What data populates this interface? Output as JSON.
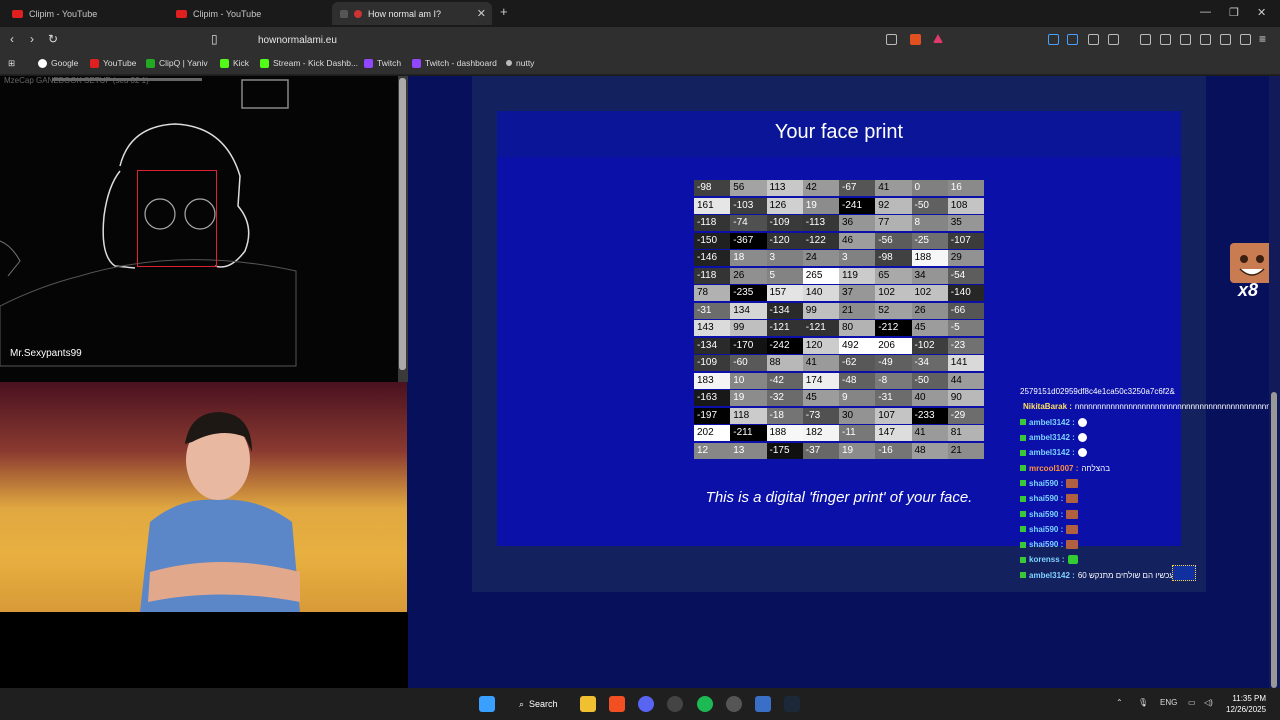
{
  "tabs": [
    {
      "title": "Clipim - YouTube"
    },
    {
      "title": "Clipim - YouTube"
    },
    {
      "title": "How normal am I?"
    }
  ],
  "url": "hownormalami.eu",
  "bookmarks": [
    "Google",
    "YouTube",
    "ClipQ | Yaniv",
    "Kick",
    "Stream - Kick Dashb...",
    "Twitch",
    "Twitch - dashboard",
    "nutty"
  ],
  "webcam": {
    "label": "Mr.Sexypants99",
    "overlay_text": "MzeCap GANEBOOK SETUP (seu 32 1)"
  },
  "card": {
    "title": "Your face print",
    "caption": "This is a digital 'finger print' of your face."
  },
  "faceprint": [
    [
      -98,
      56,
      113,
      42,
      -67,
      41,
      0,
      16
    ],
    [
      161,
      -103,
      126,
      19,
      -241,
      92,
      -50,
      108
    ],
    [
      -118,
      -74,
      -109,
      -113,
      36,
      77,
      8,
      35
    ],
    [
      -150,
      -367,
      -120,
      -122,
      46,
      -56,
      -25,
      -107
    ],
    [
      -146,
      18,
      3,
      24,
      3,
      -98,
      188,
      29
    ],
    [
      -118,
      26,
      5,
      265,
      119,
      65,
      34,
      -54
    ],
    [
      78,
      -235,
      157,
      140,
      37,
      102,
      102,
      -140
    ],
    [
      -31,
      134,
      -134,
      99,
      21,
      52,
      26,
      -66
    ],
    [
      143,
      99,
      -121,
      -121,
      80,
      -212,
      45,
      -5
    ],
    [
      -134,
      -170,
      -242,
      120,
      492,
      206,
      -102,
      -23
    ],
    [
      -109,
      -60,
      88,
      41,
      -62,
      -49,
      -34,
      141
    ],
    [
      183,
      10,
      -42,
      174,
      -48,
      -8,
      -50,
      44
    ],
    [
      -163,
      19,
      -32,
      45,
      9,
      -31,
      40,
      90
    ],
    [
      -197,
      118,
      -18,
      -73,
      30,
      107,
      -233,
      -29
    ],
    [
      202,
      -211,
      188,
      182,
      -11,
      147,
      41,
      81
    ],
    [
      12,
      13,
      -175,
      -37,
      19,
      -16,
      48,
      21
    ]
  ],
  "chat": {
    "hash": "2579151d02959df8c4e1ca50c3250a7c6f2&",
    "messages": [
      {
        "user": "NikitaBarak",
        "text": "nnnnnnnnnnnnnnnnnnnnnnnnnnnnnnnnnnnnnnnnnnnnnn",
        "emote": "",
        "color": "yellow"
      },
      {
        "user": "ambel3142",
        "text": "",
        "emote": "white",
        "color": "blue"
      },
      {
        "user": "ambel3142",
        "text": "",
        "emote": "white",
        "color": "blue"
      },
      {
        "user": "ambel3142",
        "text": "",
        "emote": "white",
        "color": "blue"
      },
      {
        "user": "mrcool1007",
        "text": "בהצלחה",
        "emote": "",
        "color": "orange"
      },
      {
        "user": "shai590",
        "text": "",
        "emote": "brown",
        "color": "blue"
      },
      {
        "user": "shai590",
        "text": "",
        "emote": "brown",
        "color": "blue"
      },
      {
        "user": "shai590",
        "text": "",
        "emote": "brown",
        "color": "blue"
      },
      {
        "user": "shai590",
        "text": "",
        "emote": "brown",
        "color": "blue"
      },
      {
        "user": "shai590",
        "text": "",
        "emote": "brown",
        "color": "blue"
      },
      {
        "user": "korenss",
        "text": "",
        "emote": "green",
        "color": "blue"
      },
      {
        "user": "ambel3142",
        "text": "60 שנה מעכשיו הם שולחים מתנקש",
        "emote": "",
        "color": "blue"
      }
    ]
  },
  "badge": "x8",
  "taskbar": {
    "search": "Search",
    "lang": "ENG",
    "time": "11:35 PM",
    "date": "12/26/2025"
  },
  "colors": {
    "page_bg": "#07105a",
    "card_bg": "#0a10a8",
    "card_head": "#0b1597"
  }
}
